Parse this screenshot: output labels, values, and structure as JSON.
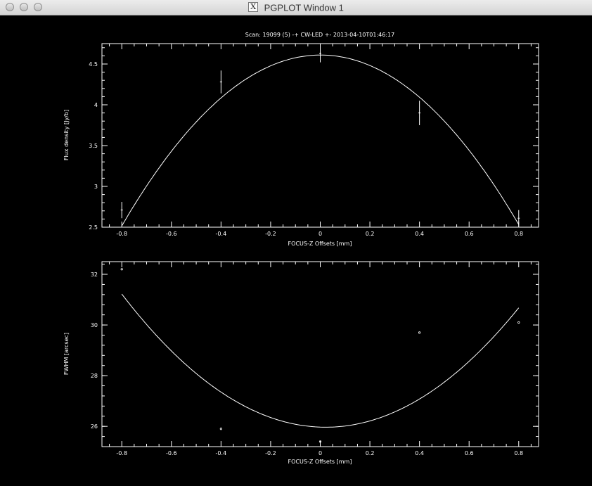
{
  "window": {
    "title": "PGPLOT Window 1",
    "app_icon": "x11-icon",
    "buttons": [
      "close",
      "minimize",
      "zoom"
    ]
  },
  "chart_data": [
    {
      "type": "scatter",
      "title": "Scan: 19099 (5) -+ CW-LED +- 2013-04-10T01:46:17",
      "xlabel": "FOCUS-Z Offsets [mm]",
      "ylabel": "Flux density [Jy/b]",
      "xlim": [
        -0.88,
        0.88
      ],
      "ylim": [
        2.5,
        4.75
      ],
      "xticks": [
        -0.8,
        -0.6,
        -0.4,
        -0.2,
        0,
        0.2,
        0.4,
        0.6,
        0.8
      ],
      "xtick_labels": [
        "-0.8",
        "-0.6",
        "-0.4",
        "-0.2",
        "0",
        "0.2",
        "0.4",
        "0.6",
        "0.8"
      ],
      "yticks": [
        2.5,
        3,
        3.5,
        4,
        4.5
      ],
      "ytick_labels": [
        "2.5",
        "3",
        "3.5",
        "4",
        "4.5"
      ],
      "points": [
        {
          "x": -0.8,
          "y": 2.71,
          "err": 0.1
        },
        {
          "x": -0.4,
          "y": 4.28,
          "err": 0.14
        },
        {
          "x": 0,
          "y": 4.63,
          "err": 0.11
        },
        {
          "x": 0.4,
          "y": 3.9,
          "err": 0.15
        },
        {
          "x": 0.8,
          "y": 2.61,
          "err": 0.1
        }
      ],
      "fit": {
        "type": "parabola",
        "a": -3.26,
        "b": 0.01,
        "c": 4.61
      }
    },
    {
      "type": "scatter",
      "title": "",
      "xlabel": "FOCUS-Z Offsets [mm]",
      "ylabel": "FWHM [arcsec]",
      "xlim": [
        -0.88,
        0.88
      ],
      "ylim": [
        25.2,
        32.5
      ],
      "xticks": [
        -0.8,
        -0.6,
        -0.4,
        -0.2,
        0,
        0.2,
        0.4,
        0.6,
        0.8
      ],
      "xtick_labels": [
        "-0.8",
        "-0.6",
        "-0.4",
        "-0.2",
        "0",
        "0.2",
        "0.4",
        "0.6",
        "0.8"
      ],
      "yticks": [
        26,
        28,
        30,
        32
      ],
      "ytick_labels": [
        "26",
        "28",
        "30",
        "32"
      ],
      "points": [
        {
          "x": -0.8,
          "y": 32.2
        },
        {
          "x": -0.4,
          "y": 25.9
        },
        {
          "x": 0,
          "y": 25.4
        },
        {
          "x": 0.4,
          "y": 29.7
        },
        {
          "x": 0.8,
          "y": 30.1
        }
      ],
      "fit": {
        "type": "parabola",
        "a": 7.78,
        "b": -0.34,
        "c": 25.97
      }
    }
  ]
}
